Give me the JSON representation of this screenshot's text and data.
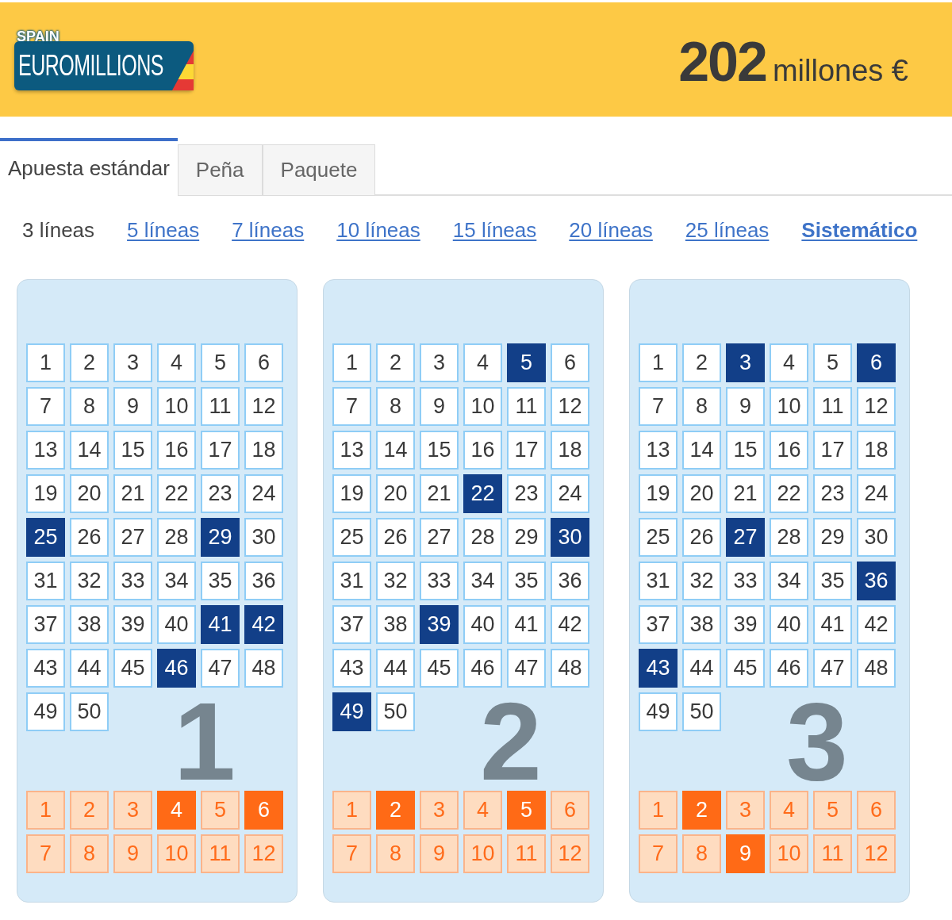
{
  "header": {
    "logo": {
      "region": "SPAIN",
      "brand": "EUROMILLIONS"
    },
    "jackpot": {
      "amount": "202",
      "unit": "millones €"
    }
  },
  "tabs": [
    {
      "label": "Apuesta estándar",
      "selected": true
    },
    {
      "label": "Peña",
      "selected": false
    },
    {
      "label": "Paquete",
      "selected": false
    }
  ],
  "line_options": [
    {
      "label": "3 líneas",
      "kind": "lines",
      "selected": true
    },
    {
      "label": "5 líneas",
      "kind": "lines",
      "selected": false
    },
    {
      "label": "7 líneas",
      "kind": "lines",
      "selected": false
    },
    {
      "label": "10 líneas",
      "kind": "lines",
      "selected": false
    },
    {
      "label": "15 líneas",
      "kind": "lines",
      "selected": false
    },
    {
      "label": "20 líneas",
      "kind": "lines",
      "selected": false
    },
    {
      "label": "25 líneas",
      "kind": "lines",
      "selected": false
    },
    {
      "label": "Sistemático",
      "kind": "system",
      "selected": false
    }
  ],
  "tickets": [
    {
      "number": "1",
      "numbers": [
        {
          "label": "1",
          "selected": false
        },
        {
          "label": "2",
          "selected": false
        },
        {
          "label": "3",
          "selected": false
        },
        {
          "label": "4",
          "selected": false
        },
        {
          "label": "5",
          "selected": false
        },
        {
          "label": "6",
          "selected": false
        },
        {
          "label": "7",
          "selected": false
        },
        {
          "label": "8",
          "selected": false
        },
        {
          "label": "9",
          "selected": false
        },
        {
          "label": "10",
          "selected": false
        },
        {
          "label": "11",
          "selected": false
        },
        {
          "label": "12",
          "selected": false
        },
        {
          "label": "13",
          "selected": false
        },
        {
          "label": "14",
          "selected": false
        },
        {
          "label": "15",
          "selected": false
        },
        {
          "label": "16",
          "selected": false
        },
        {
          "label": "17",
          "selected": false
        },
        {
          "label": "18",
          "selected": false
        },
        {
          "label": "19",
          "selected": false
        },
        {
          "label": "20",
          "selected": false
        },
        {
          "label": "21",
          "selected": false
        },
        {
          "label": "22",
          "selected": false
        },
        {
          "label": "23",
          "selected": false
        },
        {
          "label": "24",
          "selected": false
        },
        {
          "label": "25",
          "selected": true
        },
        {
          "label": "26",
          "selected": false
        },
        {
          "label": "27",
          "selected": false
        },
        {
          "label": "28",
          "selected": false
        },
        {
          "label": "29",
          "selected": true
        },
        {
          "label": "30",
          "selected": false
        },
        {
          "label": "31",
          "selected": false
        },
        {
          "label": "32",
          "selected": false
        },
        {
          "label": "33",
          "selected": false
        },
        {
          "label": "34",
          "selected": false
        },
        {
          "label": "35",
          "selected": false
        },
        {
          "label": "36",
          "selected": false
        },
        {
          "label": "37",
          "selected": false
        },
        {
          "label": "38",
          "selected": false
        },
        {
          "label": "39",
          "selected": false
        },
        {
          "label": "40",
          "selected": false
        },
        {
          "label": "41",
          "selected": true
        },
        {
          "label": "42",
          "selected": true
        },
        {
          "label": "43",
          "selected": false
        },
        {
          "label": "44",
          "selected": false
        },
        {
          "label": "45",
          "selected": false
        },
        {
          "label": "46",
          "selected": true
        },
        {
          "label": "47",
          "selected": false
        },
        {
          "label": "48",
          "selected": false
        },
        {
          "label": "49",
          "selected": false
        },
        {
          "label": "50",
          "selected": false
        }
      ],
      "stars": [
        {
          "label": "1",
          "selected": false
        },
        {
          "label": "2",
          "selected": false
        },
        {
          "label": "3",
          "selected": false
        },
        {
          "label": "4",
          "selected": true
        },
        {
          "label": "5",
          "selected": false
        },
        {
          "label": "6",
          "selected": true
        },
        {
          "label": "7",
          "selected": false
        },
        {
          "label": "8",
          "selected": false
        },
        {
          "label": "9",
          "selected": false
        },
        {
          "label": "10",
          "selected": false
        },
        {
          "label": "11",
          "selected": false
        },
        {
          "label": "12",
          "selected": false
        }
      ]
    },
    {
      "number": "2",
      "numbers": [
        {
          "label": "1",
          "selected": false
        },
        {
          "label": "2",
          "selected": false
        },
        {
          "label": "3",
          "selected": false
        },
        {
          "label": "4",
          "selected": false
        },
        {
          "label": "5",
          "selected": true
        },
        {
          "label": "6",
          "selected": false
        },
        {
          "label": "7",
          "selected": false
        },
        {
          "label": "8",
          "selected": false
        },
        {
          "label": "9",
          "selected": false
        },
        {
          "label": "10",
          "selected": false
        },
        {
          "label": "11",
          "selected": false
        },
        {
          "label": "12",
          "selected": false
        },
        {
          "label": "13",
          "selected": false
        },
        {
          "label": "14",
          "selected": false
        },
        {
          "label": "15",
          "selected": false
        },
        {
          "label": "16",
          "selected": false
        },
        {
          "label": "17",
          "selected": false
        },
        {
          "label": "18",
          "selected": false
        },
        {
          "label": "19",
          "selected": false
        },
        {
          "label": "20",
          "selected": false
        },
        {
          "label": "21",
          "selected": false
        },
        {
          "label": "22",
          "selected": true
        },
        {
          "label": "23",
          "selected": false
        },
        {
          "label": "24",
          "selected": false
        },
        {
          "label": "25",
          "selected": false
        },
        {
          "label": "26",
          "selected": false
        },
        {
          "label": "27",
          "selected": false
        },
        {
          "label": "28",
          "selected": false
        },
        {
          "label": "29",
          "selected": false
        },
        {
          "label": "30",
          "selected": true
        },
        {
          "label": "31",
          "selected": false
        },
        {
          "label": "32",
          "selected": false
        },
        {
          "label": "33",
          "selected": false
        },
        {
          "label": "34",
          "selected": false
        },
        {
          "label": "35",
          "selected": false
        },
        {
          "label": "36",
          "selected": false
        },
        {
          "label": "37",
          "selected": false
        },
        {
          "label": "38",
          "selected": false
        },
        {
          "label": "39",
          "selected": true
        },
        {
          "label": "40",
          "selected": false
        },
        {
          "label": "41",
          "selected": false
        },
        {
          "label": "42",
          "selected": false
        },
        {
          "label": "43",
          "selected": false
        },
        {
          "label": "44",
          "selected": false
        },
        {
          "label": "45",
          "selected": false
        },
        {
          "label": "46",
          "selected": false
        },
        {
          "label": "47",
          "selected": false
        },
        {
          "label": "48",
          "selected": false
        },
        {
          "label": "49",
          "selected": true
        },
        {
          "label": "50",
          "selected": false
        }
      ],
      "stars": [
        {
          "label": "1",
          "selected": false
        },
        {
          "label": "2",
          "selected": true
        },
        {
          "label": "3",
          "selected": false
        },
        {
          "label": "4",
          "selected": false
        },
        {
          "label": "5",
          "selected": true
        },
        {
          "label": "6",
          "selected": false
        },
        {
          "label": "7",
          "selected": false
        },
        {
          "label": "8",
          "selected": false
        },
        {
          "label": "9",
          "selected": false
        },
        {
          "label": "10",
          "selected": false
        },
        {
          "label": "11",
          "selected": false
        },
        {
          "label": "12",
          "selected": false
        }
      ]
    },
    {
      "number": "3",
      "numbers": [
        {
          "label": "1",
          "selected": false
        },
        {
          "label": "2",
          "selected": false
        },
        {
          "label": "3",
          "selected": true
        },
        {
          "label": "4",
          "selected": false
        },
        {
          "label": "5",
          "selected": false
        },
        {
          "label": "6",
          "selected": true
        },
        {
          "label": "7",
          "selected": false
        },
        {
          "label": "8",
          "selected": false
        },
        {
          "label": "9",
          "selected": false
        },
        {
          "label": "10",
          "selected": false
        },
        {
          "label": "11",
          "selected": false
        },
        {
          "label": "12",
          "selected": false
        },
        {
          "label": "13",
          "selected": false
        },
        {
          "label": "14",
          "selected": false
        },
        {
          "label": "15",
          "selected": false
        },
        {
          "label": "16",
          "selected": false
        },
        {
          "label": "17",
          "selected": false
        },
        {
          "label": "18",
          "selected": false
        },
        {
          "label": "19",
          "selected": false
        },
        {
          "label": "20",
          "selected": false
        },
        {
          "label": "21",
          "selected": false
        },
        {
          "label": "22",
          "selected": false
        },
        {
          "label": "23",
          "selected": false
        },
        {
          "label": "24",
          "selected": false
        },
        {
          "label": "25",
          "selected": false
        },
        {
          "label": "26",
          "selected": false
        },
        {
          "label": "27",
          "selected": true
        },
        {
          "label": "28",
          "selected": false
        },
        {
          "label": "29",
          "selected": false
        },
        {
          "label": "30",
          "selected": false
        },
        {
          "label": "31",
          "selected": false
        },
        {
          "label": "32",
          "selected": false
        },
        {
          "label": "33",
          "selected": false
        },
        {
          "label": "34",
          "selected": false
        },
        {
          "label": "35",
          "selected": false
        },
        {
          "label": "36",
          "selected": true
        },
        {
          "label": "37",
          "selected": false
        },
        {
          "label": "38",
          "selected": false
        },
        {
          "label": "39",
          "selected": false
        },
        {
          "label": "40",
          "selected": false
        },
        {
          "label": "41",
          "selected": false
        },
        {
          "label": "42",
          "selected": false
        },
        {
          "label": "43",
          "selected": true
        },
        {
          "label": "44",
          "selected": false
        },
        {
          "label": "45",
          "selected": false
        },
        {
          "label": "46",
          "selected": false
        },
        {
          "label": "47",
          "selected": false
        },
        {
          "label": "48",
          "selected": false
        },
        {
          "label": "49",
          "selected": false
        },
        {
          "label": "50",
          "selected": false
        }
      ],
      "stars": [
        {
          "label": "1",
          "selected": false
        },
        {
          "label": "2",
          "selected": true
        },
        {
          "label": "3",
          "selected": false
        },
        {
          "label": "4",
          "selected": false
        },
        {
          "label": "5",
          "selected": false
        },
        {
          "label": "6",
          "selected": false
        },
        {
          "label": "7",
          "selected": false
        },
        {
          "label": "8",
          "selected": false
        },
        {
          "label": "9",
          "selected": true
        },
        {
          "label": "10",
          "selected": false
        },
        {
          "label": "11",
          "selected": false
        },
        {
          "label": "12",
          "selected": false
        }
      ]
    }
  ]
}
